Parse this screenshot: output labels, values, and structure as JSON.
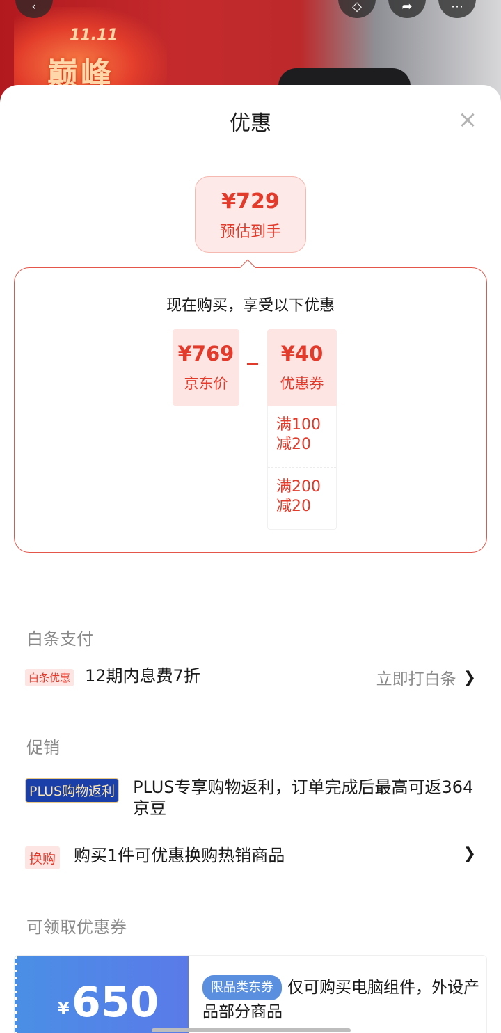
{
  "background": {
    "badge": "11.11",
    "title": "巅峰"
  },
  "sheet": {
    "title": "优惠",
    "close_icon": "close-icon"
  },
  "estimate": {
    "price": "¥729",
    "label": "预估到手"
  },
  "promo": {
    "heading": "现在购买，享受以下优惠",
    "base_price": {
      "value": "¥769",
      "label": "京东价"
    },
    "coupon_discount": {
      "value": "¥40",
      "label": "优惠券"
    },
    "coupons": [
      {
        "line1": "满100",
        "line2": "减20"
      },
      {
        "line1": "满200",
        "line2": "减20"
      }
    ]
  },
  "baitiao": {
    "section_title": "白条支付",
    "tag": "白条优惠",
    "text": "12期内息费7折",
    "action": "立即打白条"
  },
  "promotions": {
    "section_title": "促销",
    "items": [
      {
        "tag": "PLUS购物返利",
        "text": "PLUS专享购物返利，订单完成后最高可返364京豆"
      },
      {
        "tag": "换购",
        "text": "购买1件可优惠换购热销商品"
      }
    ]
  },
  "coupons_available": {
    "section_title": "可领取优惠券",
    "card": {
      "currency": "¥",
      "amount": "650",
      "scope_tag": "限品类东券",
      "description": "仅可购买电脑组件，外设产品部分商品"
    }
  },
  "colors": {
    "accent_red": "#e23b2c",
    "coupon_blue": "#4a8fe6",
    "plus_blue": "#1a3fa8"
  }
}
